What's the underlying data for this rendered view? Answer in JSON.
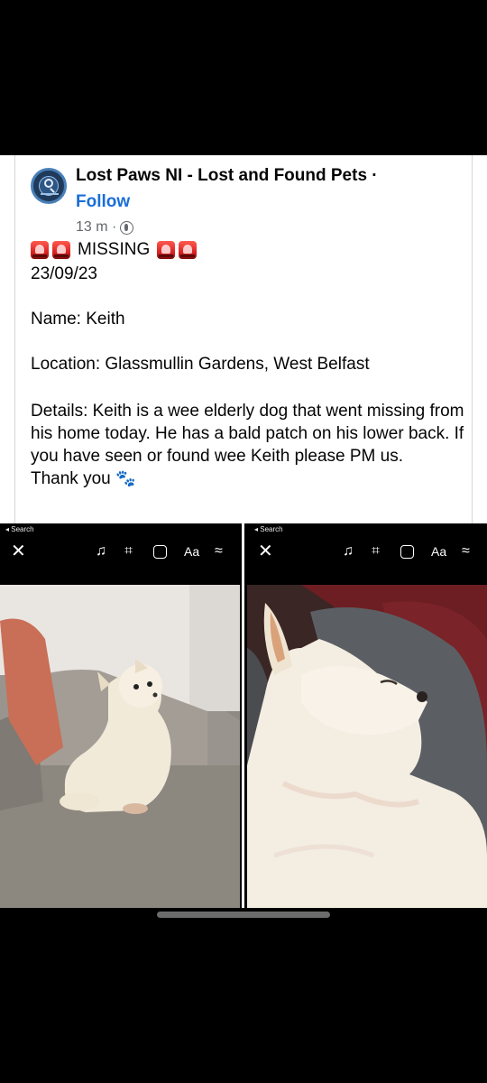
{
  "post": {
    "page_name": "Lost Paws NI - Lost and Found Pets ·",
    "follow_label": "Follow",
    "time_ago": "13 m ·",
    "missing_label": "MISSING",
    "date": "23/09/23",
    "name_line": "Name: Keith",
    "location_line": "Location: Glassmullin Gardens, West Belfast",
    "details_text": "Details: Keith is a wee elderly dog that went missing from his home today. He has a bald patch on his lower back. If you have seen or found wee Keith please PM us.",
    "thanks": "Thank you",
    "icons": {
      "avatar": "lost-paws-logo",
      "audience": "globe-icon",
      "emoji_alert": "police-car-light",
      "emoji_paws": "paw-prints"
    }
  },
  "editor_left": {
    "back_label": "◂ Search",
    "text_tool_label": "Aa",
    "icons": [
      "close-icon",
      "music-icon",
      "crop-icon",
      "sticker-icon",
      "text-icon",
      "draw-icon"
    ]
  },
  "editor_right": {
    "back_label": "◂ Search",
    "text_tool_label": "Aa",
    "icons": [
      "close-icon",
      "music-icon",
      "crop-icon",
      "sticker-icon",
      "text-icon",
      "draw-icon"
    ]
  },
  "colors": {
    "link": "#1a6ed8",
    "muted": "#65676b",
    "text": "#050505",
    "background": "#000000"
  }
}
